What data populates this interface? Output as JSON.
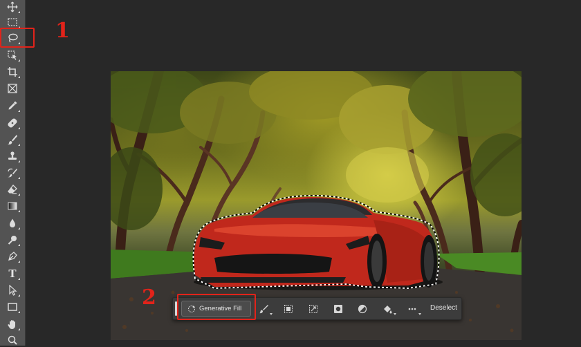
{
  "toolbar": {
    "tools": [
      {
        "icon": "move-icon",
        "name": "Move Tool"
      },
      {
        "icon": "rectangular-marquee-icon",
        "name": "Rectangular Marquee Tool"
      },
      {
        "icon": "lasso-icon",
        "name": "Lasso Tool",
        "active": true
      },
      {
        "icon": "object-selection-icon",
        "name": "Object Selection Tool"
      },
      {
        "icon": "crop-icon",
        "name": "Crop Tool"
      },
      {
        "icon": "frame-icon",
        "name": "Frame Tool"
      },
      {
        "icon": "eyedropper-icon",
        "name": "Eyedropper Tool"
      },
      {
        "icon": "healing-brush-icon",
        "name": "Spot Healing Brush Tool"
      },
      {
        "icon": "brush-icon",
        "name": "Brush Tool"
      },
      {
        "icon": "clone-stamp-icon",
        "name": "Clone Stamp Tool"
      },
      {
        "icon": "history-brush-icon",
        "name": "History Brush Tool"
      },
      {
        "icon": "eraser-icon",
        "name": "Eraser Tool"
      },
      {
        "icon": "gradient-icon",
        "name": "Gradient Tool"
      },
      {
        "icon": "blur-icon",
        "name": "Blur Tool"
      },
      {
        "icon": "dodge-icon",
        "name": "Dodge Tool"
      },
      {
        "icon": "pen-icon",
        "name": "Pen Tool"
      },
      {
        "icon": "type-icon",
        "name": "Type Tool",
        "glyph": "T"
      },
      {
        "icon": "path-selection-icon",
        "name": "Path Selection Tool"
      },
      {
        "icon": "rectangle-icon",
        "name": "Rectangle Tool"
      },
      {
        "icon": "hand-icon",
        "name": "Hand Tool"
      },
      {
        "icon": "zoom-icon",
        "name": "Zoom Tool"
      }
    ]
  },
  "annotations": {
    "step1": "1",
    "step2": "2",
    "highlight_color": "#e2231a"
  },
  "canvas": {
    "subject": "red sports car selected with marching ants on a tree-lined road"
  },
  "taskbar": {
    "generative_fill_label": "Generative Fill",
    "buttons": [
      {
        "icon": "modify-selection-icon",
        "has_dropdown": true
      },
      {
        "icon": "invert-selection-icon",
        "has_dropdown": false
      },
      {
        "icon": "transform-selection-icon",
        "has_dropdown": false
      },
      {
        "icon": "create-mask-icon",
        "has_dropdown": false
      },
      {
        "icon": "adjustment-layer-icon",
        "has_dropdown": false
      },
      {
        "icon": "fill-selection-icon",
        "has_dropdown": true
      },
      {
        "icon": "more-options-icon",
        "has_dropdown": true
      }
    ],
    "deselect_label": "Deselect"
  },
  "colors": {
    "workspace_bg": "#282828",
    "toolbar_bg": "#535353",
    "taskbar_bg": "#3c3c3c",
    "car_red": "#c0281c",
    "annotation_red": "#e2231a"
  }
}
